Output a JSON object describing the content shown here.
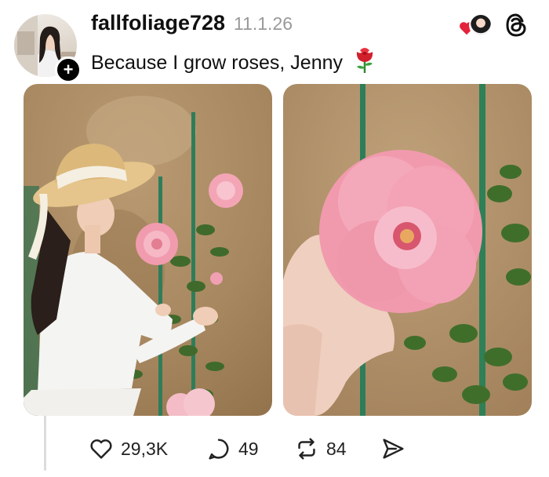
{
  "post": {
    "username": "fallfoliage728",
    "timestamp": "11.1.26",
    "caption": "Because I grow roses, Jenny",
    "caption_emoji": "rose-emoji"
  },
  "avatar": {
    "follow_label": "+"
  },
  "header_right": {
    "liker_heart_color": "#e3243b",
    "icon": "threads-logo-icon"
  },
  "photos": [
    {
      "subject": "woman in straw hat with pink roses"
    },
    {
      "subject": "hand holding pink rose"
    }
  ],
  "actions": {
    "likes": "29,3K",
    "replies": "49",
    "reposts": "84",
    "share_icon": "send-icon"
  },
  "colors": {
    "text": "#101010",
    "muted": "#999999",
    "thread_line": "#dcdcdc"
  }
}
